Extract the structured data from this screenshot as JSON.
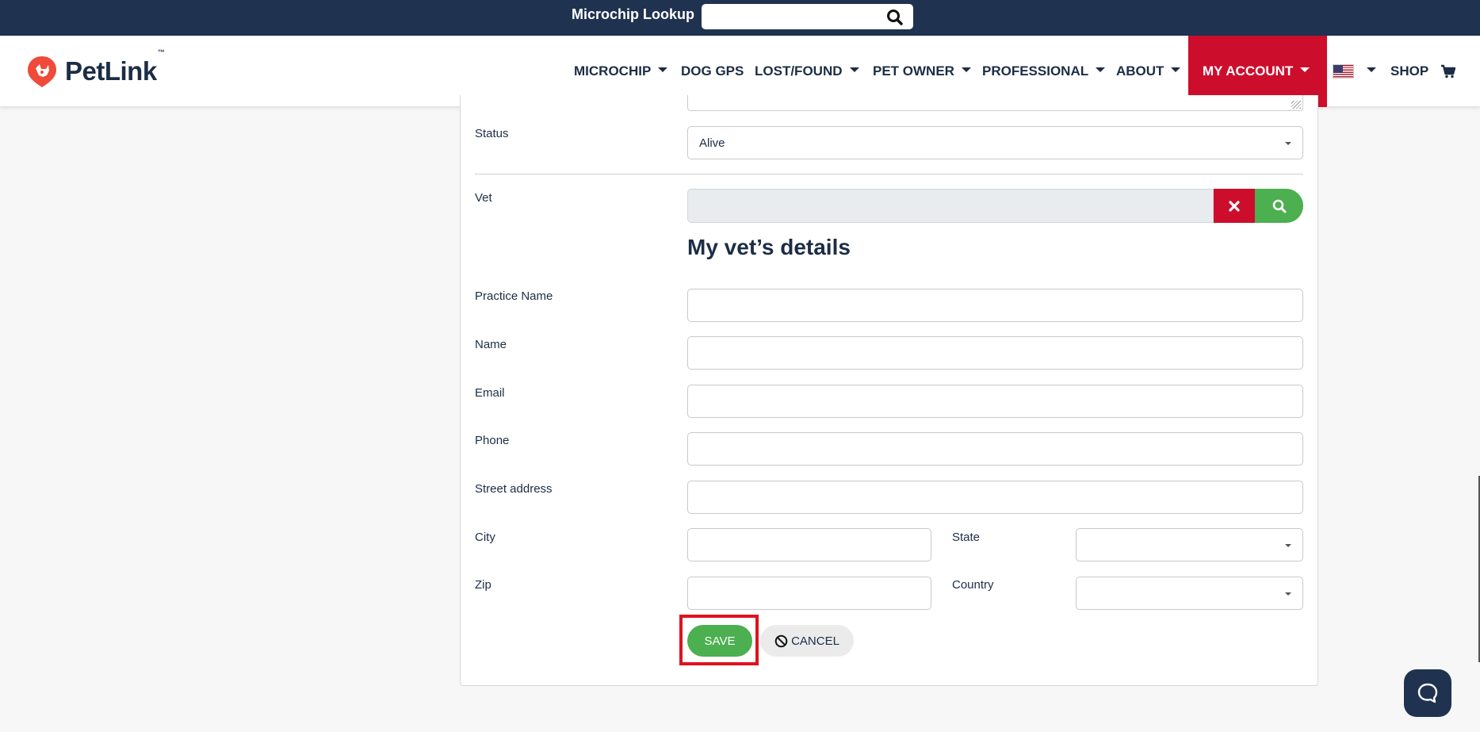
{
  "topbar": {
    "lookup_label": "Microchip Lookup",
    "lookup_value": "",
    "search_icon": "search-icon"
  },
  "header": {
    "logo_text": "PetLink",
    "logo_tm": "™",
    "nav": [
      {
        "label": "MICROCHIP",
        "has_dropdown": true
      },
      {
        "label": "DOG GPS",
        "has_dropdown": false
      },
      {
        "label": "LOST/FOUND",
        "has_dropdown": true
      },
      {
        "label": "PET OWNER",
        "has_dropdown": true
      },
      {
        "label": "PROFESSIONAL",
        "has_dropdown": true
      },
      {
        "label": "ABOUT",
        "has_dropdown": true
      },
      {
        "label": "MY ACCOUNT",
        "has_dropdown": true,
        "active": true
      },
      {
        "label": "SHOP",
        "has_dropdown": false
      }
    ],
    "language_flag": "us-flag-icon",
    "cart_icon": "cart-icon"
  },
  "form": {
    "status": {
      "label": "Status",
      "value": "Alive"
    },
    "vet": {
      "label": "Vet",
      "value": ""
    },
    "section_title": "My vet’s details",
    "practice_name": {
      "label": "Practice Name",
      "value": ""
    },
    "name": {
      "label": "Name",
      "value": ""
    },
    "email": {
      "label": "Email",
      "value": ""
    },
    "phone": {
      "label": "Phone",
      "value": ""
    },
    "street": {
      "label": "Street address",
      "value": ""
    },
    "city": {
      "label": "City",
      "value": ""
    },
    "state": {
      "label": "State",
      "value": ""
    },
    "zip": {
      "label": "Zip",
      "value": ""
    },
    "country": {
      "label": "Country",
      "value": ""
    },
    "save_label": "SAVE",
    "cancel_label": "CANCEL"
  },
  "colors": {
    "navy": "#1f3350",
    "accent_red": "#cc0e2c",
    "green": "#4caf50"
  }
}
